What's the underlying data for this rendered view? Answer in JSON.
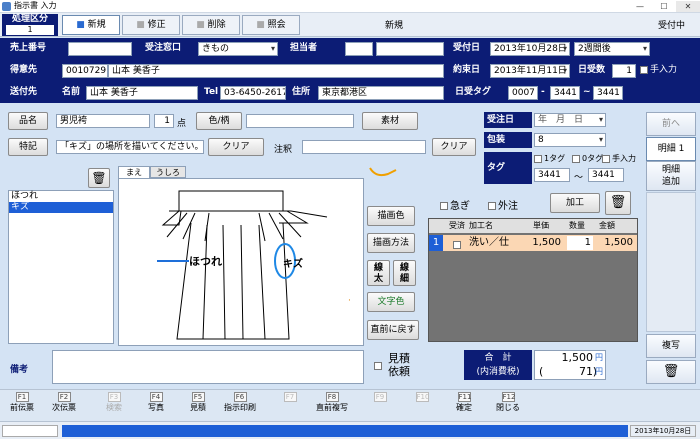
{
  "window": {
    "title": "指示書 入力",
    "min": "—",
    "max": "☐",
    "close": "✕"
  },
  "mode": {
    "label": "処理区分",
    "value": "1",
    "tabs": [
      "新規",
      "修正",
      "削除",
      "照会"
    ],
    "current": "新規",
    "status": "受付中"
  },
  "header": {
    "sales_no_label": "売上番号",
    "sales_no": "",
    "window_label": "受注窓口",
    "window_value": "きもの",
    "staff_label": "担当者",
    "staff": "",
    "order_date_label": "受付日",
    "order_date": "2013年10月28日",
    "order_period": "2週間後",
    "customer_label": "得意先",
    "customer_code": "0010729",
    "customer_name": "山本 美香子",
    "promise_label": "約束日",
    "promise_date": "2013年11月11日",
    "days_label": "日受数",
    "days": "1",
    "manual": "手入力",
    "ship_label": "送付先",
    "name_label": "名前",
    "ship_name": "山本 美香子",
    "tel_label": "Tel",
    "tel": "03-6450-2617",
    "addr_label": "住所",
    "addr": "東京都港区",
    "tag_label": "日受タグ",
    "tag_code": "0007",
    "tag_from": "3441",
    "tag_to": "3441"
  },
  "item": {
    "name_label": "品名",
    "name": "男児袴",
    "qty": "1",
    "qty_unit": "点",
    "color_label": "色/柄",
    "color": "",
    "material_button": "素材"
  },
  "note": {
    "label": "特記",
    "text": "「キズ」の場所を描いてください。",
    "clear1": "クリア",
    "memo_label": "注釈",
    "memo": "",
    "clear2": "クリア"
  },
  "receive": {
    "date_label": "受注日",
    "date": "年　月　日",
    "pack_label": "包装",
    "pack": "8",
    "tag_label": "タグ",
    "tag1": "1タグ",
    "tag0": "0タグ",
    "manual": "手入力",
    "tag_from": "3441",
    "tag_to": "3441"
  },
  "defects": {
    "items": [
      "ほつれ",
      "キズ"
    ],
    "selected": 1
  },
  "canvas": {
    "tab_front": "まえ",
    "tab_back": "うしろ",
    "annot1": "ほつれ",
    "annot2": "キズ"
  },
  "draw_buttons": {
    "color": "描画色",
    "method": "描画方法",
    "thick": "線\n太",
    "thin": "線\n細",
    "text_color": "文字色",
    "undo": "直前に戻す"
  },
  "options": {
    "urgent": "急ぎ",
    "outsourced": "外注",
    "process_button": "加工"
  },
  "table": {
    "headers": [
      "受済",
      "加工名",
      "単価",
      "数量",
      "金額"
    ],
    "rows": [
      {
        "no": "1",
        "name": "洗い／仕",
        "price": "1,500",
        "qty": "1",
        "amount": "1,500"
      }
    ]
  },
  "remarks": {
    "label": "備考",
    "value": "",
    "estimate": "見積\n依頼"
  },
  "total": {
    "label1": "合　計",
    "label2": "(内消費税)",
    "amount": "1,500",
    "tax": "71",
    "unit": "円"
  },
  "side": {
    "prev": "前へ",
    "detail1": "明細 1",
    "add_detail": "明細\n追加",
    "copy": "複写"
  },
  "fkeys": [
    {
      "k": "F1",
      "label": "前伝票",
      "enabled": true
    },
    {
      "k": "F2",
      "label": "次伝票",
      "enabled": true
    },
    {
      "k": "F3",
      "label": "検索",
      "enabled": false
    },
    {
      "k": "F4",
      "label": "写真",
      "enabled": true
    },
    {
      "k": "F5",
      "label": "見積",
      "enabled": true
    },
    {
      "k": "F6",
      "label": "指示印刷",
      "enabled": true
    },
    {
      "k": "F7",
      "label": "",
      "enabled": false
    },
    {
      "k": "F8",
      "label": "直前複写",
      "enabled": true
    },
    {
      "k": "F9",
      "label": "",
      "enabled": false
    },
    {
      "k": "F10",
      "label": "",
      "enabled": false
    },
    {
      "k": "F11",
      "label": "確定",
      "enabled": true
    },
    {
      "k": "F12",
      "label": "閉じる",
      "enabled": true
    }
  ],
  "statusbar": {
    "date": "2013年10月28日"
  },
  "colors": {
    "navy": "#0c1c75",
    "panel": "#d4e3f4",
    "highlight": "#1e5fd6",
    "row": "#fbd7b4"
  }
}
